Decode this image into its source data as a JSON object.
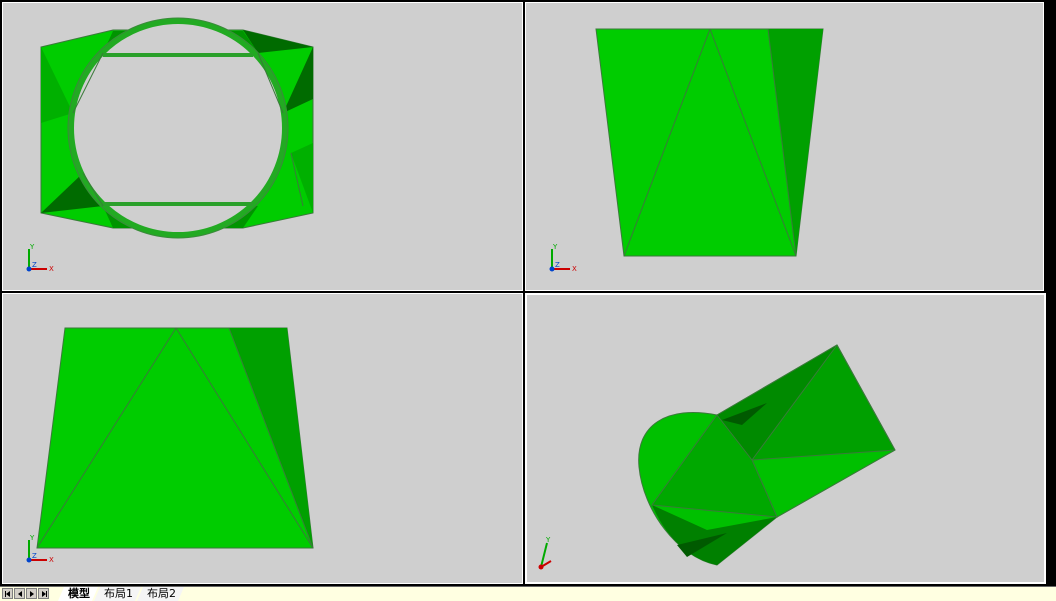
{
  "viewports": [
    {
      "id": "top-left",
      "view": "top"
    },
    {
      "id": "top-right",
      "view": "front"
    },
    {
      "id": "bottom-left",
      "view": "left"
    },
    {
      "id": "bottom-right",
      "view": "isometric"
    }
  ],
  "ucs": {
    "x_label": "X",
    "y_label": "Y",
    "z_label": "Z"
  },
  "colors": {
    "background": "#cfcfcf",
    "model_light": "#00cc00",
    "model_mid": "#00a000",
    "model_dark": "#006b00",
    "edge": "#3a7a3a",
    "statusbar_bg": "#ffffe1"
  },
  "layout_tabs": {
    "items": [
      {
        "label": "模型",
        "active": true
      },
      {
        "label": "布局1",
        "active": false
      },
      {
        "label": "布局2",
        "active": false
      }
    ]
  }
}
